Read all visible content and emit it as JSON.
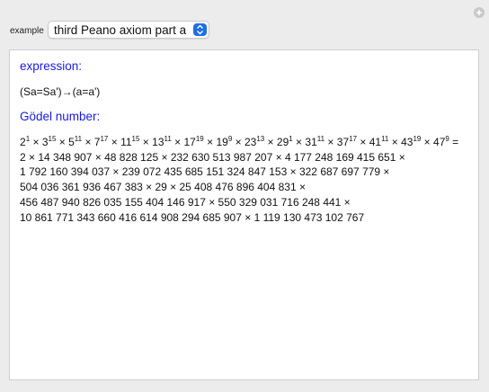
{
  "toolbar": {
    "example_label": "example",
    "selected_example": "third Peano axiom part a"
  },
  "panel": {
    "expression_heading": "expression:",
    "expression": "(Sa=Sa')→(a=a')",
    "godel_heading": "Gödel number:",
    "factorization": [
      {
        "base": "2",
        "exp": "1"
      },
      {
        "base": "3",
        "exp": "15"
      },
      {
        "base": "5",
        "exp": "11"
      },
      {
        "base": "7",
        "exp": "17"
      },
      {
        "base": "11",
        "exp": "15"
      },
      {
        "base": "13",
        "exp": "11"
      },
      {
        "base": "17",
        "exp": "19"
      },
      {
        "base": "19",
        "exp": "9"
      },
      {
        "base": "23",
        "exp": "13"
      },
      {
        "base": "29",
        "exp": "1"
      },
      {
        "base": "31",
        "exp": "11"
      },
      {
        "base": "37",
        "exp": "17"
      },
      {
        "base": "41",
        "exp": "11"
      },
      {
        "base": "43",
        "exp": "19"
      },
      {
        "base": "47",
        "exp": "9"
      }
    ],
    "product_lines": [
      "2 × 14 348 907 × 48 828 125 × 232 630 513 987 207 × 4 177 248 169 415 651 ×",
      "1 792 160 394 037 × 239 072 435 685 151 324 847 153 × 322 687 697 779 ×",
      "504 036 361 936 467 383 × 29 × 25 408 476 896 404 831 ×",
      "456 487 940 826 035 155 404 146 917 × 550 329 031 716 248 441 ×",
      "10 861 771 343 660 416 614 908 294 685 907 × 1 119 130 473 102 767"
    ]
  }
}
